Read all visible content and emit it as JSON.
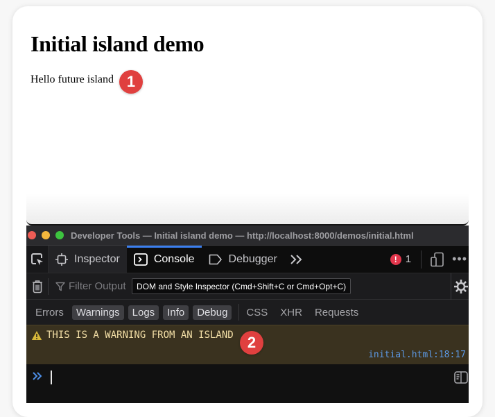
{
  "page": {
    "title": "Initial island demo",
    "text": "Hello future island",
    "badge_1": "1",
    "badge_2": "2"
  },
  "devtools": {
    "window_title": "Developer Tools — Initial island demo — http://localhost:8000/demos/initial.html",
    "tabs": [
      {
        "label": "Inspector",
        "icon": "inspector-icon",
        "active": false
      },
      {
        "label": "Console",
        "icon": "console-icon",
        "active": true
      },
      {
        "label": "Debugger",
        "icon": "debugger-icon",
        "active": false
      }
    ],
    "error_count": "1",
    "filter_placeholder": "Filter Output",
    "tooltip": "DOM and Style Inspector (Cmd+Shift+C or Cmd+Opt+C)",
    "levels": [
      {
        "label": "Errors",
        "on": false
      },
      {
        "label": "Warnings",
        "on": true
      },
      {
        "label": "Logs",
        "on": true
      },
      {
        "label": "Info",
        "on": true
      },
      {
        "label": "Debug",
        "on": true
      }
    ],
    "categories": [
      "CSS",
      "XHR",
      "Requests"
    ],
    "messages": [
      {
        "level": "warning",
        "text": "THIS IS A WARNING FROM AN ISLAND",
        "location": "initial.html:18:17"
      }
    ],
    "colors": {
      "active_tab": "#3b7ff0",
      "warning_bg": "#3a321f",
      "warning_text": "#f3dfa6",
      "link": "#5d9ae6",
      "error": "#e2364c",
      "badge": "#e0403f"
    }
  }
}
